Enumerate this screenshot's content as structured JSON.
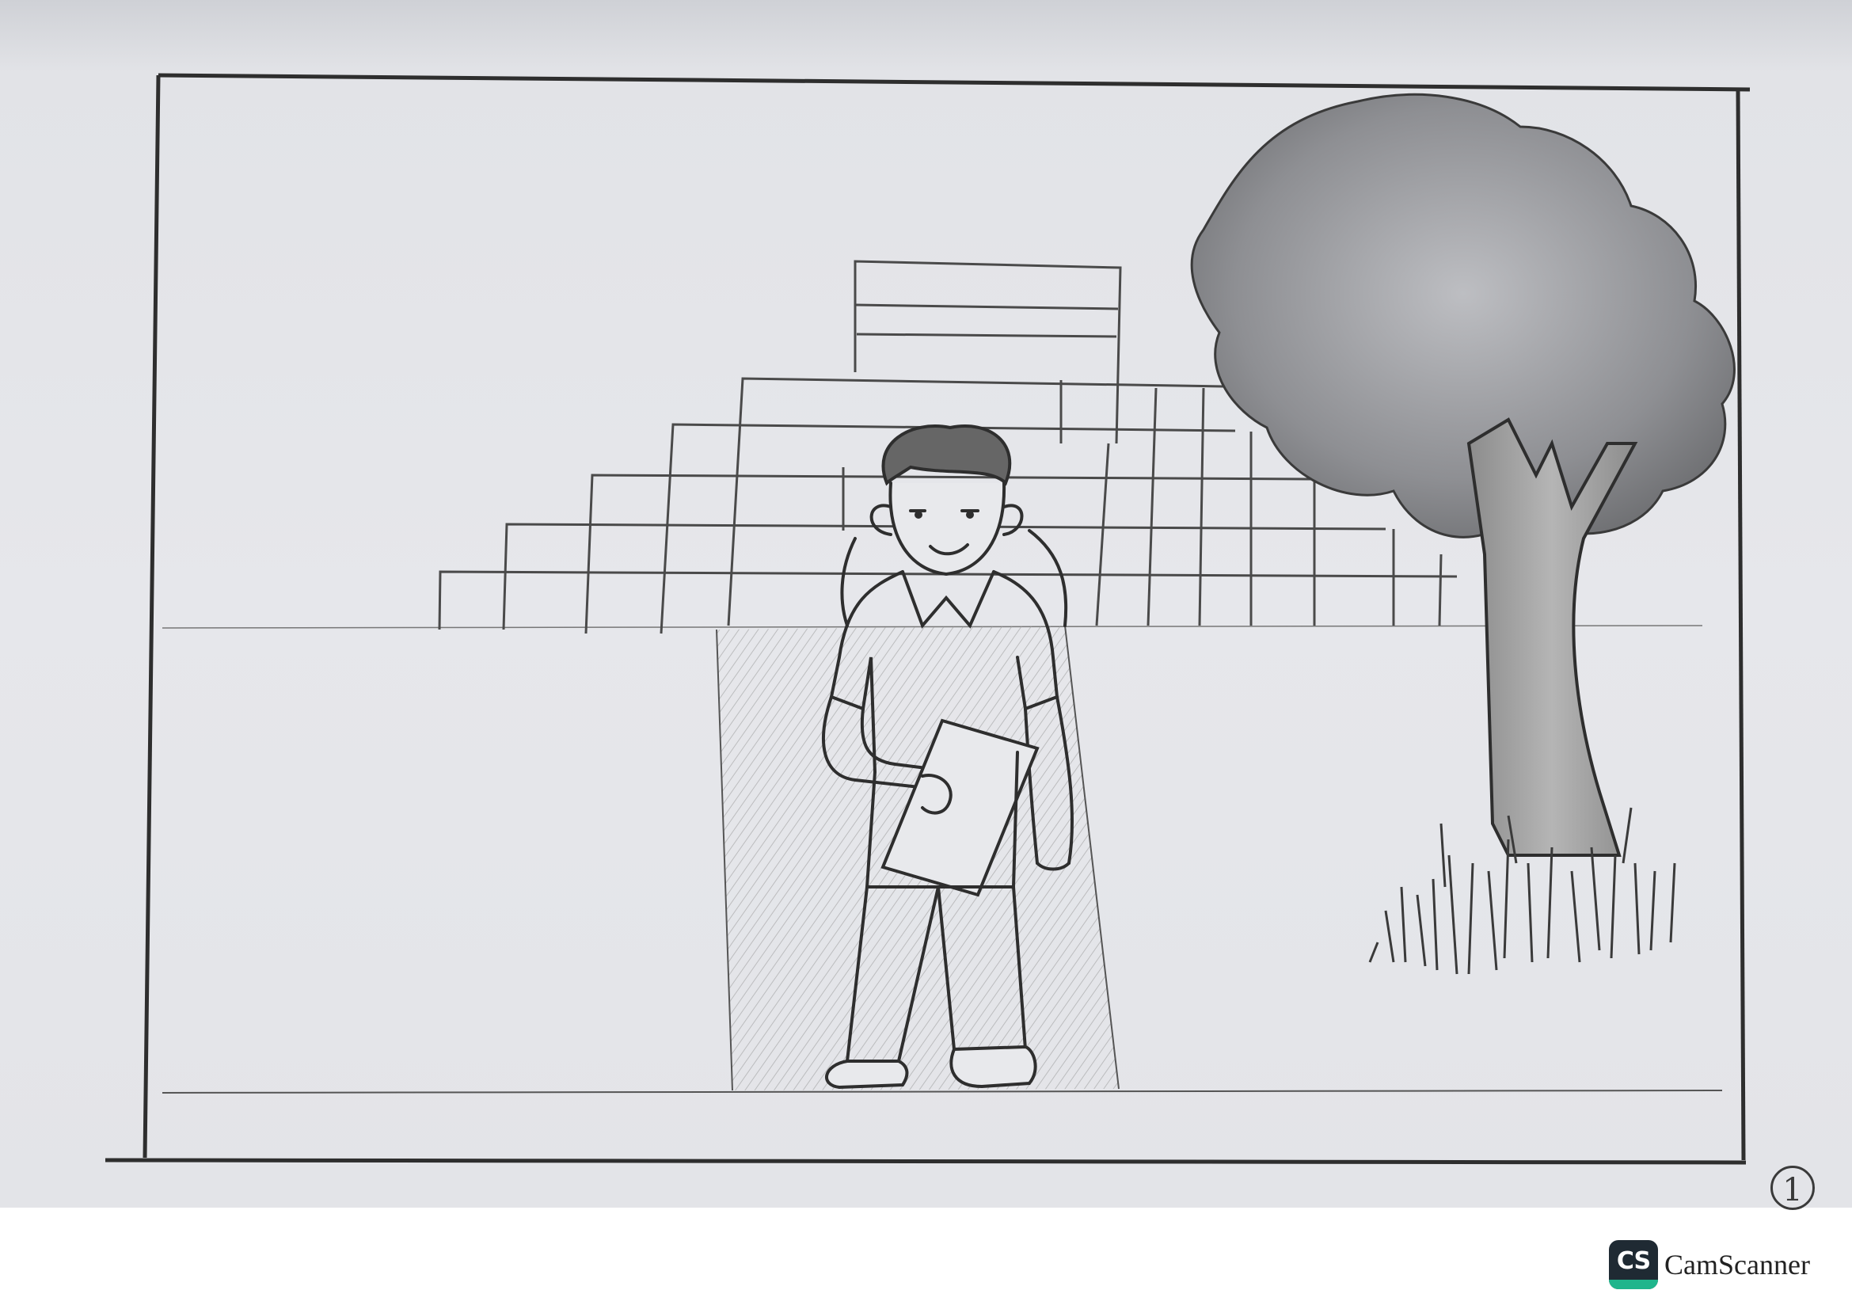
{
  "scene": {
    "description_hidden": "",
    "colors": {
      "paper": "#e6e7eb",
      "pencil": "#333333",
      "shading": "#8a8a8a"
    }
  },
  "page_number": "1",
  "watermark": {
    "logo_text": "CS",
    "app_name": "CamScanner"
  }
}
